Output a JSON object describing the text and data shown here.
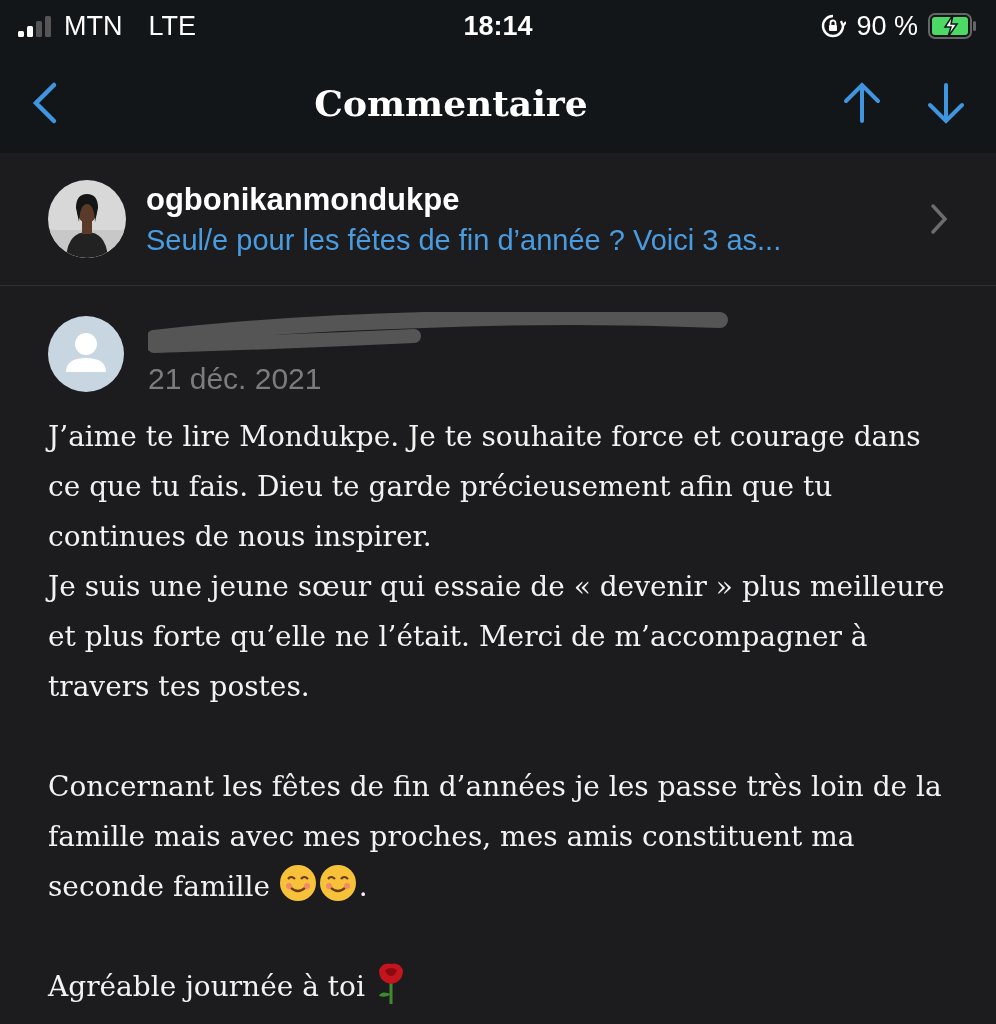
{
  "status_bar": {
    "carrier": "MTN",
    "network": "LTE",
    "time": "18:14",
    "battery": "90 %",
    "charging": true
  },
  "nav": {
    "title": "Commentaire"
  },
  "post": {
    "author": "ogbonikanmondukpe",
    "title": "Seul/e pour les fêtes de fin d’année ? Voici 3 as..."
  },
  "comment": {
    "author_redacted": true,
    "date": "21 déc. 2021",
    "paragraphs": [
      {
        "kind": "plain",
        "text": "J’aime te lire Mondukpe. Je te souhaite force et courage dans ce que tu fais. Dieu te garde précieusement afin que tu continues de nous inspirer.\nJe suis une jeune sœur qui essaie de « devenir » plus meilleure et plus forte qu’elle ne l’était. Merci de m’accompagner à travers tes postes."
      },
      {
        "kind": "smiles",
        "text": "Concernant les fêtes de fin d’années je les passe très loin de la famille mais avec mes proches, mes amis constituent ma seconde famille ",
        "after": "."
      },
      {
        "kind": "rose",
        "text": "Agréable journée à toi "
      }
    ]
  }
}
